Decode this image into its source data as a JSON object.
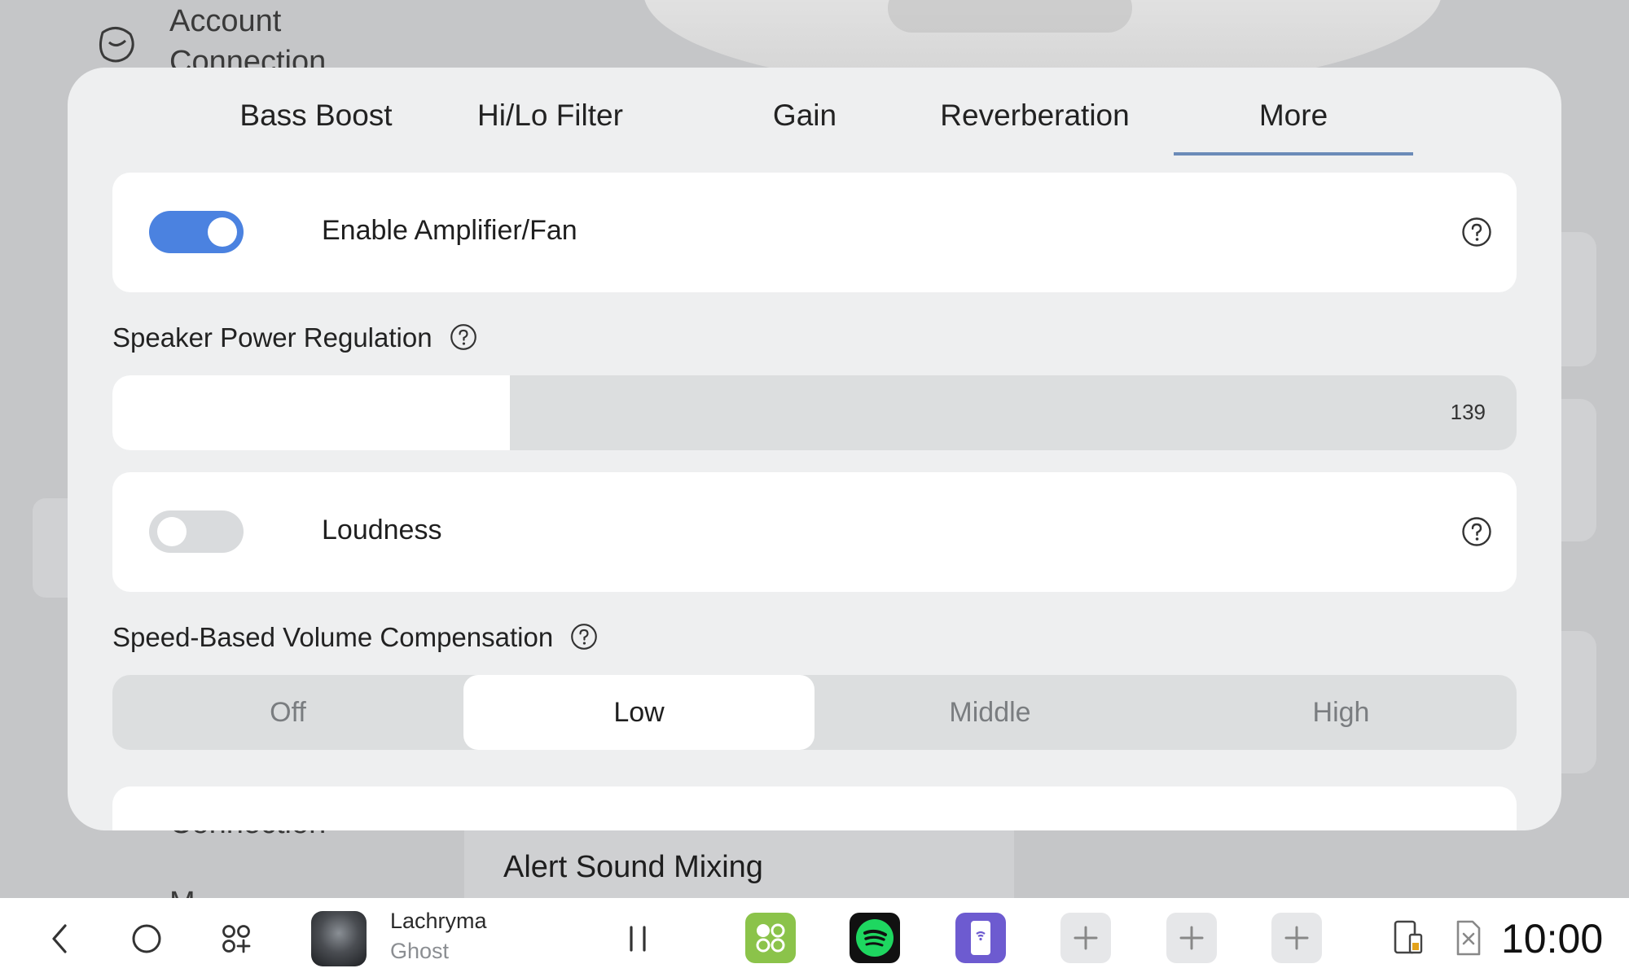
{
  "background": {
    "side_menu": [
      "Account",
      "Connection"
    ],
    "bottom_menu": [
      "Connection",
      "M"
    ],
    "panel_label": "Alert Sound Mixing"
  },
  "tabs": [
    {
      "label": "Bass Boost",
      "active": false
    },
    {
      "label": "Hi/Lo Filter",
      "active": false
    },
    {
      "label": "Gain",
      "active": false
    },
    {
      "label": "Reverberation",
      "active": false
    },
    {
      "label": "More",
      "active": true
    }
  ],
  "amplifier": {
    "label": "Enable Amplifier/Fan",
    "enabled": true
  },
  "speaker_power": {
    "title": "Speaker Power Regulation",
    "value": "139",
    "fill_fraction": 0.283
  },
  "loudness": {
    "label": "Loudness",
    "enabled": false
  },
  "speed_compensation": {
    "title": "Speed-Based Volume Compensation",
    "options": [
      "Off",
      "Low",
      "Middle",
      "High"
    ],
    "selected": "Low"
  },
  "taskbar": {
    "now_playing": {
      "title": "Lachryma",
      "artist": "Ghost"
    },
    "apps": [
      {
        "icon": "app-grid-green-icon",
        "color": "#8bc34a"
      },
      {
        "icon": "spotify-icon",
        "color": "#111111"
      },
      {
        "icon": "wireless-phone-app-icon",
        "color": "#6d5bd0"
      }
    ],
    "clock": "10:00"
  },
  "colors": {
    "accent": "#4b82e0",
    "tab_underline": "#6b8bb8"
  }
}
